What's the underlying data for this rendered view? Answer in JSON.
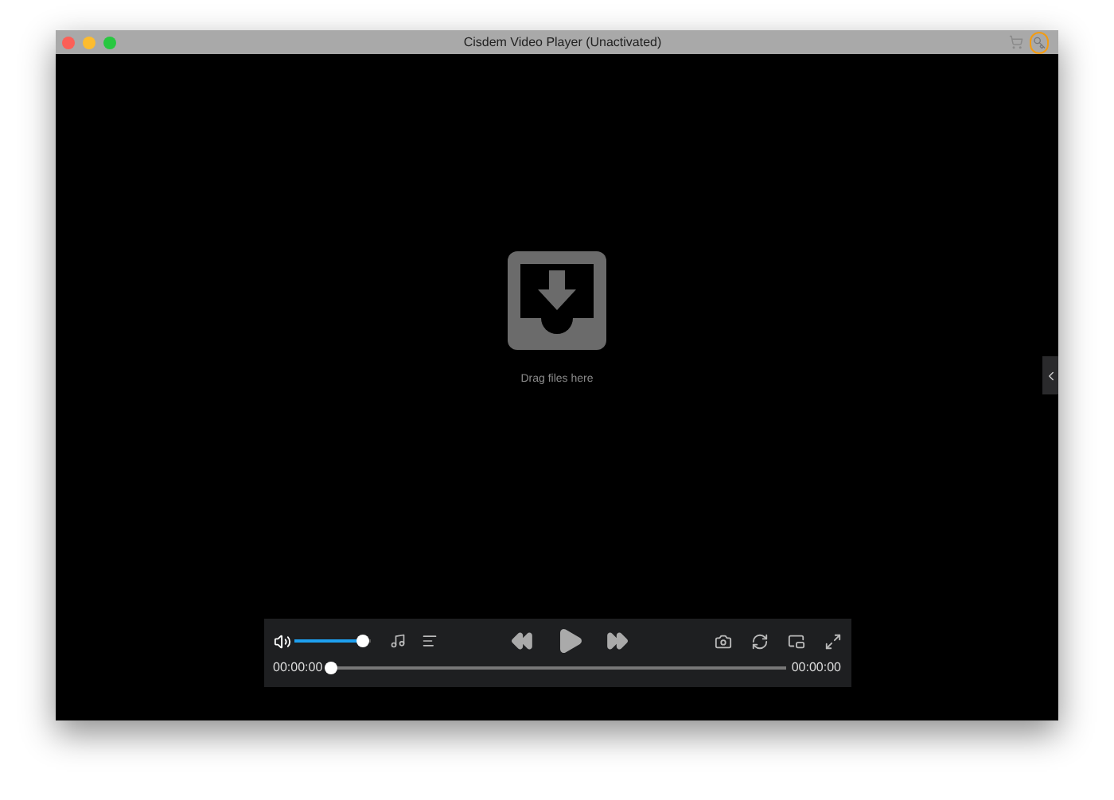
{
  "window": {
    "title": "Cisdem Video Player (Unactivated)"
  },
  "drop_zone": {
    "label": "Drag files here"
  },
  "controls": {
    "volume": {
      "level": 0.9
    },
    "current_time": "00:00:00",
    "total_time": "00:00:00",
    "progress": {
      "level": 0
    }
  }
}
